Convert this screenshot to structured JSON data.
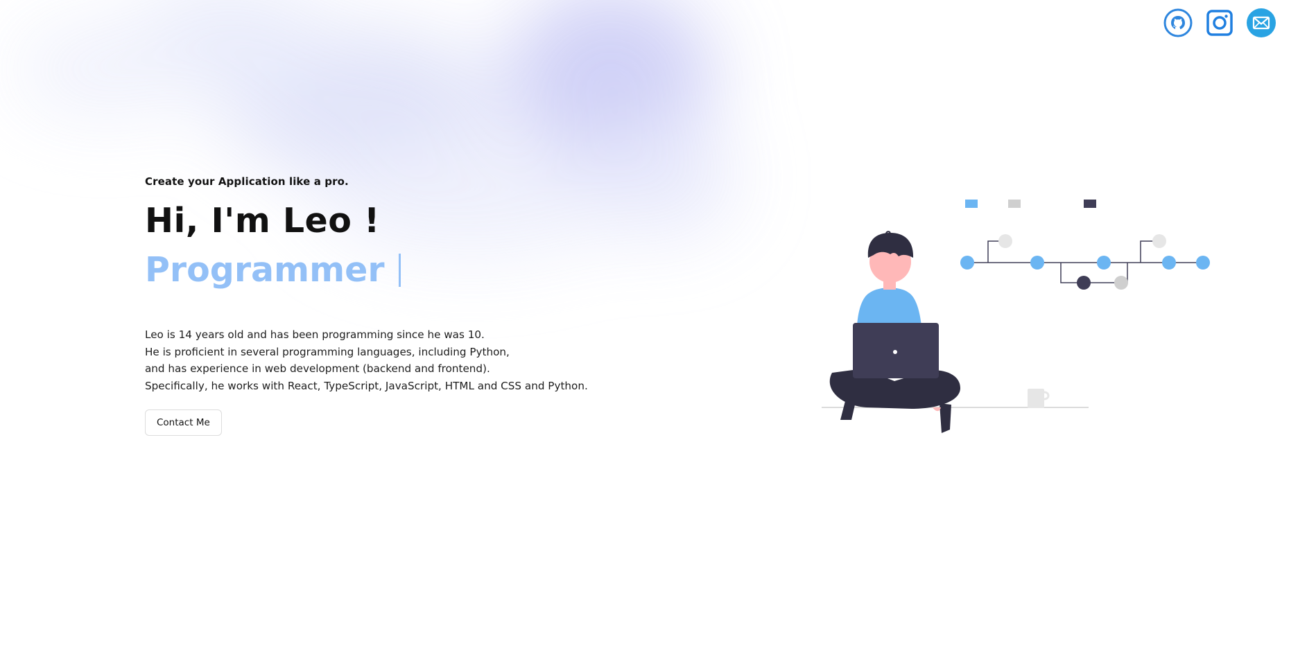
{
  "colors": {
    "accent": "#93c0f7",
    "github_blue": "#2e86de",
    "illustration_blue": "#6bb5f2",
    "illustration_dark": "#3f3d56",
    "skin": "#ffb8b8"
  },
  "social": {
    "github_icon": "github-icon",
    "instagram_icon": "instagram-icon",
    "mail_icon": "mail-icon"
  },
  "hero": {
    "tagline": "Create your Application like a pro.",
    "headline": "Hi, I'm Leo !",
    "role": "Programmer",
    "bio": [
      "Leo is 14 years old and has been programming since he was 10.",
      "He is proficient in several programming languages, including Python,",
      "and has experience in web development (backend and frontend).",
      "Specifically, he works with React, TypeScript, JavaScript, HTML and CSS and Python."
    ],
    "contact_label": "Contact Me"
  }
}
